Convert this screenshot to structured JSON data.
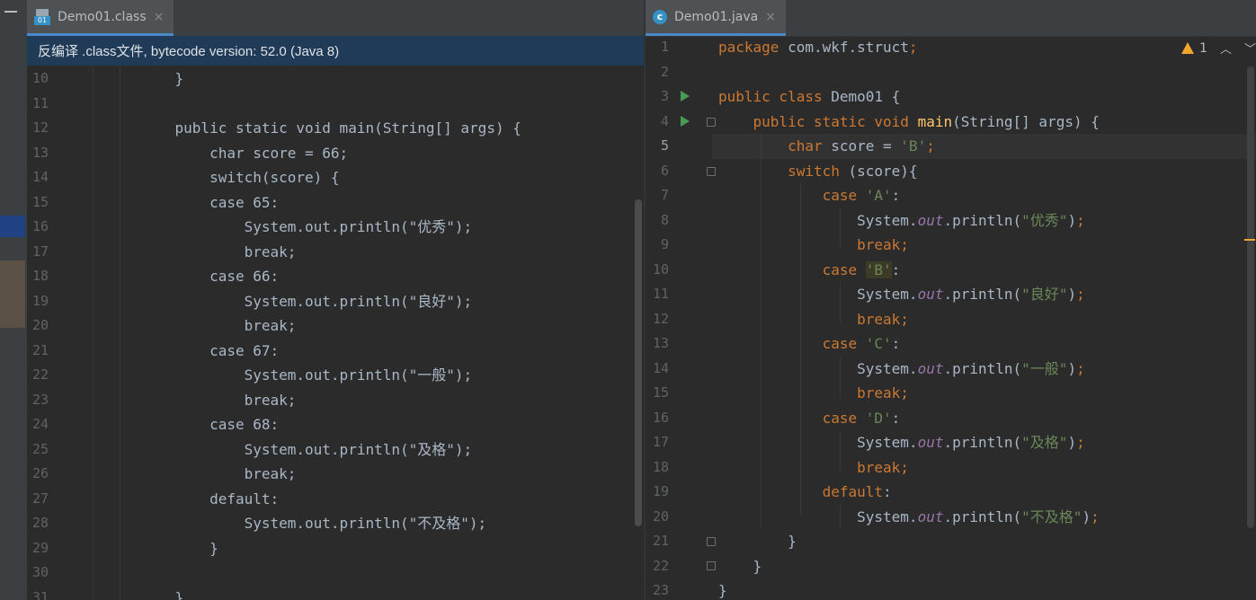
{
  "left_panel": {
    "tab": {
      "title": "Demo01.class",
      "close": "×",
      "icon": "class-file-icon"
    },
    "banner": "反编译 .class文件, bytecode version: 52.0 (Java 8)",
    "first_line": 10,
    "lines": [
      "    }",
      "",
      "    public static void main(String[] args) {",
      "        char score = 66;",
      "        switch(score) {",
      "        case 65:",
      "            System.out.println(\"优秀\");",
      "            break;",
      "        case 66:",
      "            System.out.println(\"良好\");",
      "            break;",
      "        case 67:",
      "            System.out.println(\"一般\");",
      "            break;",
      "        case 68:",
      "            System.out.println(\"及格\");",
      "            break;",
      "        default:",
      "            System.out.println(\"不及格\");",
      "        }",
      "",
      "    }"
    ]
  },
  "right_panel": {
    "tab": {
      "title": "Demo01.java",
      "close": "×",
      "icon": "java-class-icon"
    },
    "inspections": {
      "warnings": "1",
      "icon": "warning-icon"
    },
    "current_line": 5,
    "run_lines": [
      3,
      4
    ],
    "first_line": 1,
    "lines": [
      [
        [
          "kw",
          "package "
        ],
        [
          "p",
          "com.wkf.struct"
        ],
        [
          "kw",
          ";"
        ]
      ],
      [],
      [
        [
          "kw",
          "public class "
        ],
        [
          "p",
          "Demo01 {"
        ]
      ],
      [
        [
          "p",
          "    "
        ],
        [
          "kw",
          "public static void "
        ],
        [
          "fn",
          "main"
        ],
        [
          "p",
          "(String[] args) {"
        ]
      ],
      [
        [
          "p",
          "        "
        ],
        [
          "kw",
          "char "
        ],
        [
          "p",
          "score = "
        ],
        [
          "st",
          "'B'"
        ],
        [
          "kw",
          ";"
        ]
      ],
      [
        [
          "p",
          "        "
        ],
        [
          "kw",
          "switch "
        ],
        [
          "p",
          "(score){"
        ]
      ],
      [
        [
          "p",
          "            "
        ],
        [
          "kw",
          "case "
        ],
        [
          "st",
          "'A'"
        ],
        [
          "p",
          ":"
        ]
      ],
      [
        [
          "p",
          "                System."
        ],
        [
          "it",
          "out"
        ],
        [
          "p",
          ".println("
        ],
        [
          "st",
          "\"优秀\""
        ],
        [
          "p",
          ")"
        ],
        [
          "kw",
          ";"
        ]
      ],
      [
        [
          "p",
          "                "
        ],
        [
          "kw",
          "break;"
        ]
      ],
      [
        [
          "p",
          "            "
        ],
        [
          "kw",
          "case "
        ],
        [
          "sth",
          "'B'"
        ],
        [
          "p",
          ":"
        ]
      ],
      [
        [
          "p",
          "                System."
        ],
        [
          "it",
          "out"
        ],
        [
          "p",
          ".println("
        ],
        [
          "st",
          "\"良好\""
        ],
        [
          "p",
          ")"
        ],
        [
          "kw",
          ";"
        ]
      ],
      [
        [
          "p",
          "                "
        ],
        [
          "kw",
          "break;"
        ]
      ],
      [
        [
          "p",
          "            "
        ],
        [
          "kw",
          "case "
        ],
        [
          "st",
          "'C'"
        ],
        [
          "p",
          ":"
        ]
      ],
      [
        [
          "p",
          "                System."
        ],
        [
          "it",
          "out"
        ],
        [
          "p",
          ".println("
        ],
        [
          "st",
          "\"一般\""
        ],
        [
          "p",
          ")"
        ],
        [
          "kw",
          ";"
        ]
      ],
      [
        [
          "p",
          "                "
        ],
        [
          "kw",
          "break;"
        ]
      ],
      [
        [
          "p",
          "            "
        ],
        [
          "kw",
          "case "
        ],
        [
          "st",
          "'D'"
        ],
        [
          "p",
          ":"
        ]
      ],
      [
        [
          "p",
          "                System."
        ],
        [
          "it",
          "out"
        ],
        [
          "p",
          ".println("
        ],
        [
          "st",
          "\"及格\""
        ],
        [
          "p",
          ")"
        ],
        [
          "kw",
          ";"
        ]
      ],
      [
        [
          "p",
          "                "
        ],
        [
          "kw",
          "break;"
        ]
      ],
      [
        [
          "p",
          "            "
        ],
        [
          "kw",
          "default"
        ],
        [
          "p",
          ":"
        ]
      ],
      [
        [
          "p",
          "                System."
        ],
        [
          "it",
          "out"
        ],
        [
          "p",
          ".println("
        ],
        [
          "st",
          "\"不及格\""
        ],
        [
          "p",
          ")"
        ],
        [
          "kw",
          ";"
        ]
      ],
      [
        [
          "p",
          "        }"
        ]
      ],
      [
        [
          "p",
          "    }"
        ]
      ],
      [
        [
          "p",
          "}"
        ]
      ]
    ]
  }
}
